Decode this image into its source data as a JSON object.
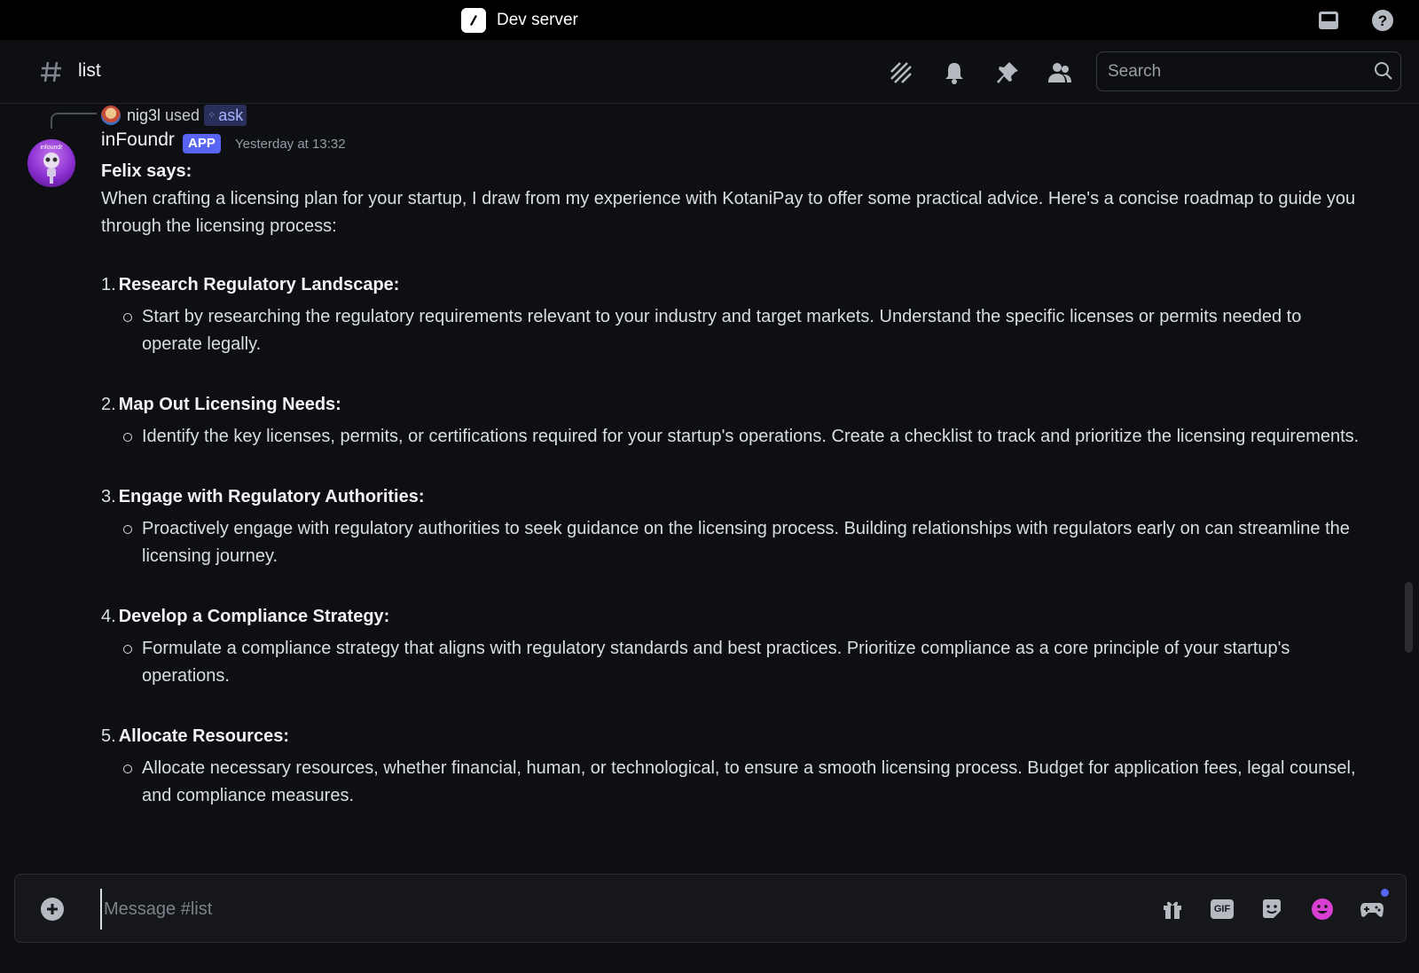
{
  "window": {
    "server_name": "Dev server"
  },
  "header": {
    "channel_name": "list",
    "search_placeholder": "Search"
  },
  "reply": {
    "user": "nig3l",
    "used": "used",
    "command": "ask"
  },
  "message": {
    "author": "inFoundr",
    "badge": "APP",
    "timestamp": "Yesterday at 13:32",
    "says": "Felix says:",
    "intro": "When crafting a licensing plan for your startup, I draw from my experience with KotaniPay to offer some practical advice. Here's a concise roadmap to guide you through the licensing process:",
    "steps": [
      {
        "num": "1.",
        "title": "Research Regulatory Landscape:",
        "detail": "Start by researching the regulatory requirements relevant to your industry and target markets. Understand the specific licenses or permits needed to operate legally."
      },
      {
        "num": "2.",
        "title": "Map Out Licensing Needs:",
        "detail": "Identify the key licenses, permits, or certifications required for your startup's operations. Create a checklist to track and prioritize the licensing requirements."
      },
      {
        "num": "3.",
        "title": "Engage with Regulatory Authorities:",
        "detail": "Proactively engage with regulatory authorities to seek guidance on the licensing process. Building relationships with regulators early on can streamline the licensing journey."
      },
      {
        "num": "4.",
        "title": "Develop a Compliance Strategy:",
        "detail": "Formulate a compliance strategy that aligns with regulatory standards and best practices. Prioritize compliance as a core principle of your startup's operations."
      },
      {
        "num": "5.",
        "title": "Allocate Resources:",
        "detail": "Allocate necessary resources, whether financial, human, or technological, to ensure a smooth licensing process. Budget for application fees, legal counsel, and compliance measures."
      }
    ]
  },
  "composer": {
    "placeholder": "Message #list",
    "gif_label": "GIF"
  },
  "colors": {
    "accent": "#5865f2",
    "background": "#0e0f13",
    "emoji_accent": "#d93fd1"
  }
}
